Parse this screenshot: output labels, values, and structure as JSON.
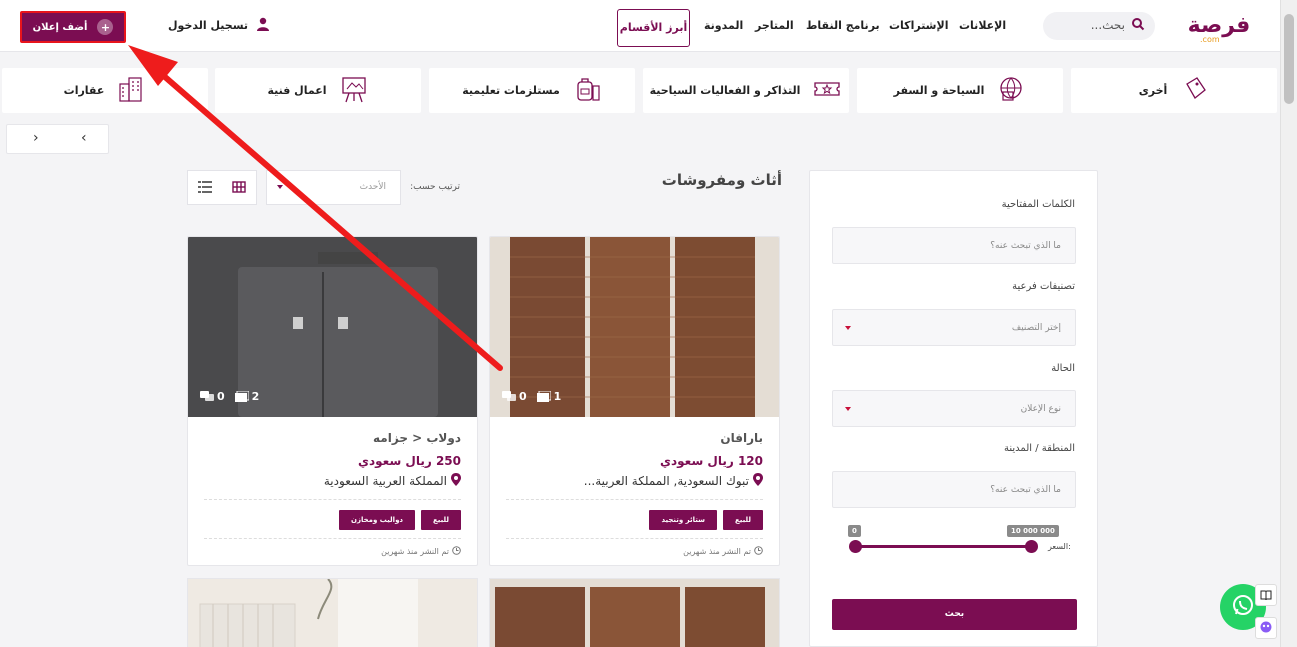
{
  "header": {
    "logo_text": "فرصة",
    "logo_sub": ".com",
    "search_placeholder": "بحث...",
    "nav": [
      "الإعلانات",
      "الإشتراكات",
      "برنامج النقاط",
      "المتاجر",
      "المدونة"
    ],
    "nav_active": "أبرز الأقسام",
    "login": "تسجيل الدخول",
    "add_ad": "أضف إعلان",
    "add_ad_plus": "+"
  },
  "categories": [
    {
      "label": "أخرى",
      "icon": "tag-icon"
    },
    {
      "label": "السياحة و السفر",
      "icon": "travel-globe-icon"
    },
    {
      "label": "التذاكر و الفعاليات السياحية",
      "icon": "ticket-icon"
    },
    {
      "label": "مستلزمات تعليمية",
      "icon": "school-bag-icon"
    },
    {
      "label": "اعمال فنية",
      "icon": "easel-icon"
    },
    {
      "label": "عقارات",
      "icon": "buildings-icon"
    }
  ],
  "pager": {
    "prev": "‹",
    "next": "›"
  },
  "listing": {
    "title": "أثاث ومفروشات",
    "sort_label": "ترتيب حسب:",
    "sort_value": "الأحدث"
  },
  "cards": [
    {
      "title": "بارافان",
      "price": "120 ريال سعودي",
      "location": "تبوك السعودية, المملكة العربية...",
      "images": "1",
      "comments": "0",
      "tags": [
        "للبيع",
        "ستائر وتنجيد"
      ],
      "posted": "تم النشر منذ شهرين"
    },
    {
      "title": "دولاب < جزامه",
      "price": "250 ريال سعودي",
      "location": "المملكة العربية السعودية",
      "images": "2",
      "comments": "0",
      "tags": [
        "للبيع",
        "دواليب ومخازن"
      ],
      "posted": "تم النشر منذ شهرين"
    }
  ],
  "filter": {
    "keywords_label": "الكلمات المفتاحية",
    "keywords_placeholder": "ما الذي تبحث عنه؟",
    "subcat_label": "تصنيفات فرعية",
    "subcat_value": "إختر التصنيف",
    "status_label": "الحالة",
    "status_value": "نوع الإعلان",
    "region_label": "المنطقة / المدينة",
    "region_placeholder": "ما الذي تبحث عنه؟",
    "price_label": ":السعر",
    "price_min": "0",
    "price_max": "10 000 000",
    "search_button": "بحث"
  },
  "colors": {
    "brand": "#7b0d52",
    "accent_red": "#e8141c",
    "whatsapp": "#25d366"
  }
}
